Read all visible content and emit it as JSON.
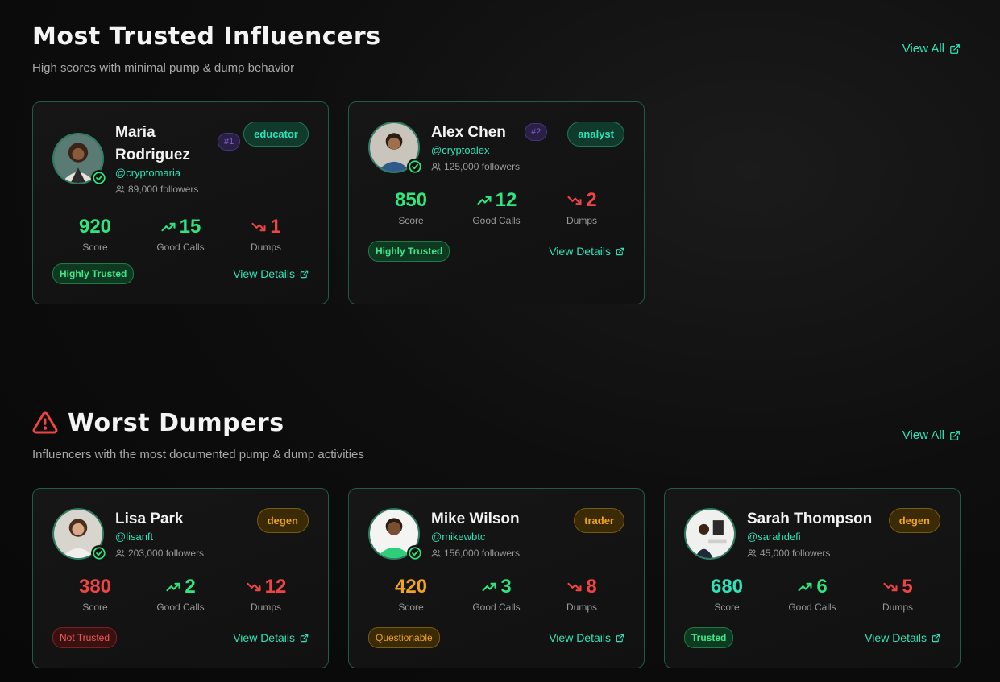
{
  "trusted": {
    "title": "Most Trusted Influencers",
    "subtitle": "High scores with minimal pump & dump behavior",
    "view_all": "View All",
    "cards": [
      {
        "name": "Maria Rodriguez",
        "name_line1": "Maria",
        "name_line2": "Rodriguez",
        "handle": "@cryptomaria",
        "followers": "89,000 followers",
        "rank": "#1",
        "tag": "educator",
        "score": "920",
        "good_calls": "15",
        "dumps": "1",
        "score_label": "Score",
        "good_label": "Good Calls",
        "dumps_label": "Dumps",
        "trust": "Highly Trusted",
        "details": "View Details"
      },
      {
        "name": "Alex Chen",
        "handle": "@cryptoalex",
        "followers": "125,000 followers",
        "rank": "#2",
        "tag": "analyst",
        "score": "850",
        "good_calls": "12",
        "dumps": "2",
        "score_label": "Score",
        "good_label": "Good Calls",
        "dumps_label": "Dumps",
        "trust": "Highly Trusted",
        "details": "View Details"
      }
    ]
  },
  "dumpers": {
    "title": "Worst Dumpers",
    "subtitle": "Influencers with the most documented pump & dump activities",
    "view_all": "View All",
    "cards": [
      {
        "name": "Lisa Park",
        "handle": "@lisanft",
        "followers": "203,000 followers",
        "tag": "degen",
        "score": "380",
        "good_calls": "2",
        "dumps": "12",
        "score_label": "Score",
        "good_label": "Good Calls",
        "dumps_label": "Dumps",
        "trust": "Not Trusted",
        "details": "View Details"
      },
      {
        "name": "Mike Wilson",
        "handle": "@mikewbtc",
        "followers": "156,000 followers",
        "tag": "trader",
        "score": "420",
        "good_calls": "3",
        "dumps": "8",
        "score_label": "Score",
        "good_label": "Good Calls",
        "dumps_label": "Dumps",
        "trust": "Questionable",
        "details": "View Details"
      },
      {
        "name": "Sarah Thompson",
        "handle": "@sarahdefi",
        "followers": "45,000 followers",
        "tag": "degen",
        "score": "680",
        "good_calls": "6",
        "dumps": "5",
        "score_label": "Score",
        "good_label": "Good Calls",
        "dumps_label": "Dumps",
        "trust": "Trusted",
        "details": "View Details"
      }
    ]
  },
  "colors": {
    "accent": "#2de3b7",
    "good": "#2ee57f",
    "bad": "#ef4444",
    "warn": "#f0a41e"
  },
  "icons": [
    "external-link-icon",
    "warning-icon",
    "verified-check-icon",
    "users-icon",
    "trending-up-icon",
    "trending-down-icon"
  ]
}
